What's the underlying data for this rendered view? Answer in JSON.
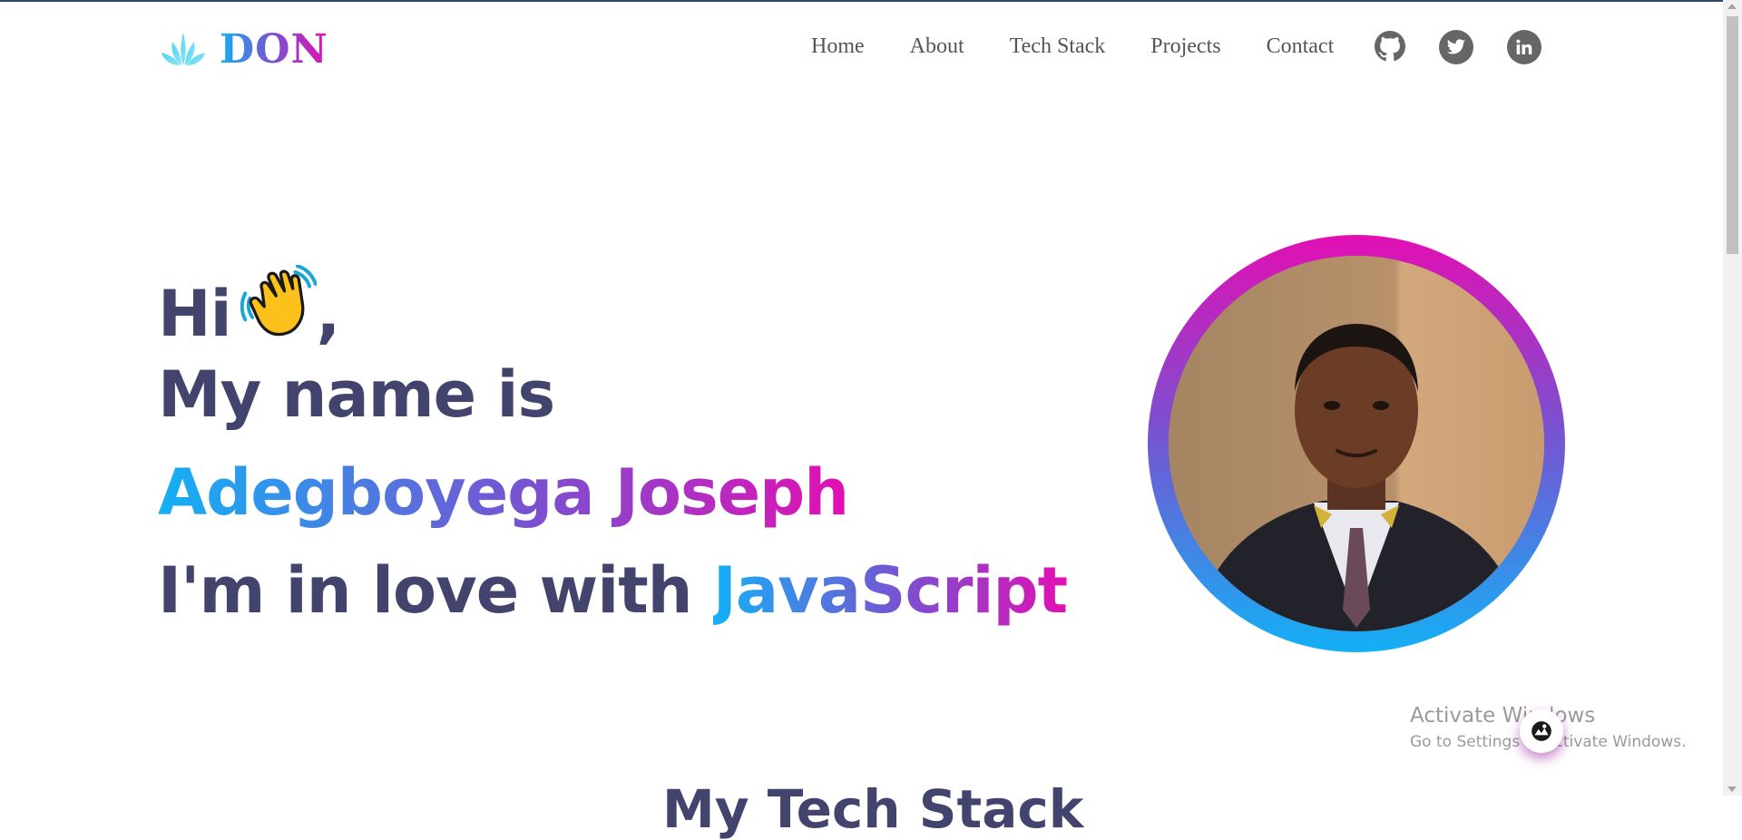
{
  "header": {
    "logo_text": "DON",
    "nav": [
      "Home",
      "About",
      "Tech Stack",
      "Projects",
      "Contact"
    ],
    "social": [
      "github-icon",
      "twitter-icon",
      "linkedin-icon"
    ]
  },
  "hero": {
    "greeting": "Hi",
    "greeting_comma": ",",
    "intro": "My name is",
    "name": "Adegboyega Joseph",
    "love_prefix": "I'm in love with",
    "love_highlight": "JavaScript"
  },
  "sections": {
    "tech_stack_title": "My Tech Stack"
  },
  "watermark": {
    "title": "Activate Windows",
    "subtitle": "Go to Settings to activate Windows."
  },
  "colors": {
    "heading": "#42446e",
    "gradient_start": "#13b0f5",
    "gradient_mid": "#7c4fd0",
    "gradient_end": "#e30fb3",
    "nav_text": "#555555",
    "social_bg": "#666666"
  }
}
